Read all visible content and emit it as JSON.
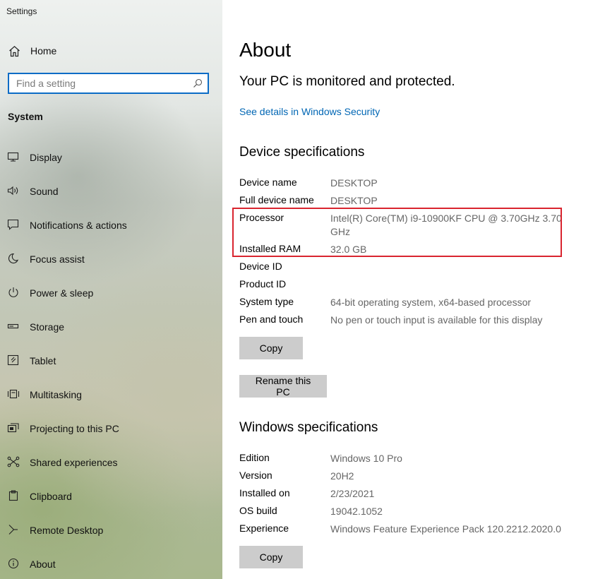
{
  "window": {
    "title": "Settings"
  },
  "sidebar": {
    "home_label": "Home",
    "search": {
      "placeholder": "Find a setting",
      "value": ""
    },
    "section_title": "System",
    "items": [
      {
        "label": "Display",
        "icon": "display-icon"
      },
      {
        "label": "Sound",
        "icon": "sound-icon"
      },
      {
        "label": "Notifications & actions",
        "icon": "notifications-icon"
      },
      {
        "label": "Focus assist",
        "icon": "focus-assist-icon"
      },
      {
        "label": "Power & sleep",
        "icon": "power-icon"
      },
      {
        "label": "Storage",
        "icon": "storage-icon"
      },
      {
        "label": "Tablet",
        "icon": "tablet-icon"
      },
      {
        "label": "Multitasking",
        "icon": "multitasking-icon"
      },
      {
        "label": "Projecting to this PC",
        "icon": "projecting-icon"
      },
      {
        "label": "Shared experiences",
        "icon": "shared-experiences-icon"
      },
      {
        "label": "Clipboard",
        "icon": "clipboard-icon"
      },
      {
        "label": "Remote Desktop",
        "icon": "remote-desktop-icon"
      },
      {
        "label": "About",
        "icon": "info-icon"
      }
    ]
  },
  "main": {
    "title": "About",
    "protection_status": "Your PC is monitored and protected.",
    "security_link": "See details in Windows Security",
    "device_specs": {
      "heading": "Device specifications",
      "rows": [
        {
          "key": "Device name",
          "value": "DESKTOP"
        },
        {
          "key": "Full device name",
          "value": "DESKTOP"
        },
        {
          "key": "Processor",
          "value": "Intel(R) Core(TM) i9-10900KF CPU @ 3.70GHz   3.70 GHz"
        },
        {
          "key": "Installed RAM",
          "value": "32.0 GB"
        },
        {
          "key": "Device ID",
          "value": ""
        },
        {
          "key": "Product ID",
          "value": ""
        },
        {
          "key": "System type",
          "value": "64-bit operating system, x64-based processor"
        },
        {
          "key": "Pen and touch",
          "value": "No pen or touch input is available for this display"
        }
      ],
      "copy_label": "Copy",
      "rename_label": "Rename this PC"
    },
    "windows_specs": {
      "heading": "Windows specifications",
      "rows": [
        {
          "key": "Edition",
          "value": "Windows 10 Pro"
        },
        {
          "key": "Version",
          "value": "20H2"
        },
        {
          "key": "Installed on",
          "value": "2/23/2021"
        },
        {
          "key": "OS build",
          "value": "19042.1052"
        },
        {
          "key": "Experience",
          "value": "Windows Feature Experience Pack 120.2212.2020.0"
        }
      ],
      "copy_label": "Copy"
    },
    "highlight_color": "#d9252f",
    "link_color": "#0066b4"
  }
}
